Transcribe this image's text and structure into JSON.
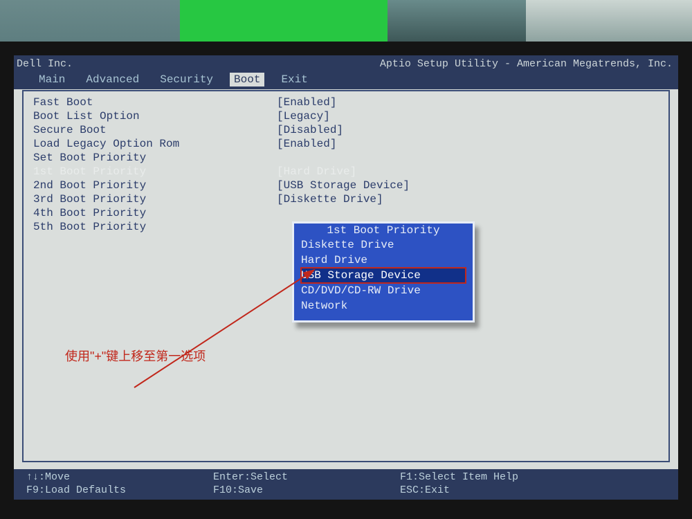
{
  "ambient": "photo of a laptop on a desk showing BIOS setup",
  "vendor": "Dell Inc.",
  "utility_title": "Aptio Setup Utility - American Megatrends, Inc.",
  "tabs": {
    "items": [
      "Main",
      "Advanced",
      "Security",
      "Boot",
      "Exit"
    ],
    "active": "Boot"
  },
  "settings": [
    {
      "label": "Fast Boot",
      "value": "[Enabled]",
      "selected": false
    },
    {
      "label": "",
      "value": ""
    },
    {
      "label": "Boot List Option",
      "value": "[Legacy]",
      "selected": false
    },
    {
      "label": "Secure Boot",
      "value": "[Disabled]",
      "selected": false
    },
    {
      "label": "Load Legacy Option Rom",
      "value": "[Enabled]",
      "selected": false
    },
    {
      "label": "Set Boot Priority",
      "value": "",
      "selected": false
    },
    {
      "label": "1st Boot Priority",
      "value": "[Hard Drive]",
      "selected": true
    },
    {
      "label": "2nd Boot Priority",
      "value": "[USB Storage Device]",
      "selected": false
    },
    {
      "label": "3rd Boot Priority",
      "value": "[Diskette Drive]",
      "selected": false
    },
    {
      "label": "4th Boot Priority",
      "value": "",
      "selected": false
    },
    {
      "label": "5th Boot Priority",
      "value": "",
      "selected": false
    }
  ],
  "popup": {
    "title": "1st Boot Priority",
    "options": [
      "Diskette Drive",
      "Hard Drive",
      "USB Storage Device",
      "CD/DVD/CD-RW Drive",
      "Network"
    ],
    "highlighted": "USB Storage Device"
  },
  "annotation_text": "使用\"+\"键上移至第一选项",
  "footer": {
    "row1": {
      "c1": "↑↓:Move",
      "c2": "Enter:Select",
      "c3": "F1:Select Item Help"
    },
    "row2": {
      "c1": "F9:Load Defaults",
      "c2": "F10:Save",
      "c3": "ESC:Exit"
    }
  }
}
